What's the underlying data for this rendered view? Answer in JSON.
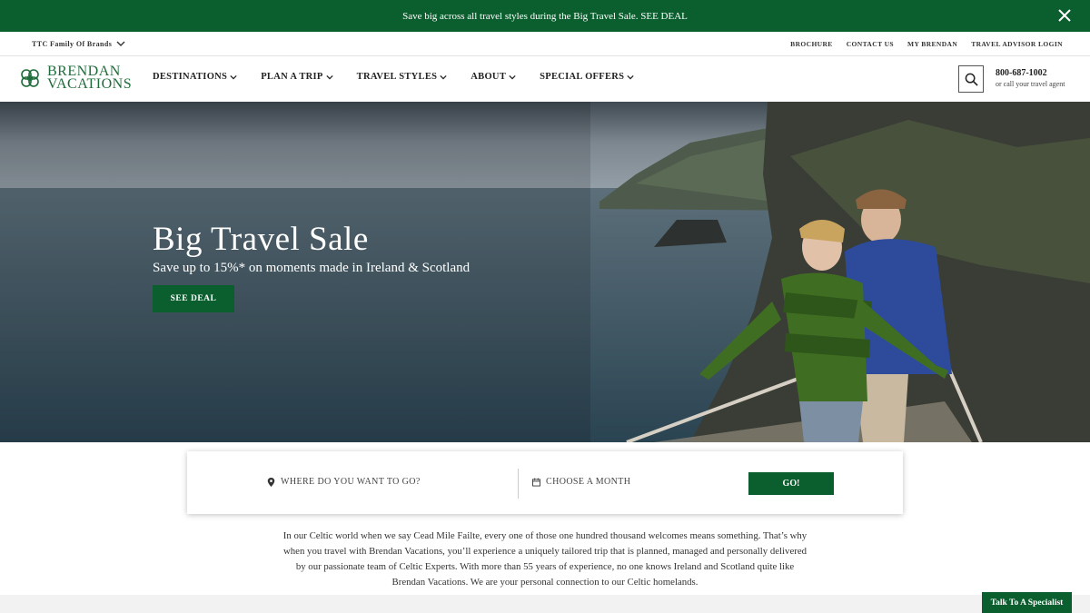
{
  "promo": {
    "text": "Save big across all travel styles during the Big Travel Sale. SEE DEAL",
    "close_icon": "close-icon"
  },
  "utility": {
    "family_label": "TTC Family Of Brands",
    "links": [
      "BROCHURE",
      "CONTACT US",
      "MY BRENDAN",
      "TRAVEL ADVISOR LOGIN"
    ]
  },
  "nav": {
    "logo_line1": "BRENDAN",
    "logo_line2": "VACATIONS",
    "menu": [
      "DESTINATIONS",
      "PLAN A TRIP",
      "TRAVEL STYLES",
      "ABOUT",
      "SPECIAL OFFERS"
    ],
    "phone": "800-687-1002",
    "phone_sub": "or call your travel agent"
  },
  "hero": {
    "title": "Big Travel Sale",
    "subtitle": "Save up to 15%* on moments made in Ireland & Scotland",
    "button": "SEE DEAL"
  },
  "search": {
    "where": "WHERE DO YOU WANT TO GO?",
    "month": "CHOOSE A MONTH",
    "go": "GO!"
  },
  "intro": "In our Celtic world when we say Cead Mile Failte, every one of those one hundred thousand welcomes means something. That’s why when you travel with Brendan Vacations, you’ll experience a uniquely tailored trip that is planned, managed and personally delivered by our passionate team of Celtic Experts. With more than 55 years of experience, no one knows Ireland and Scotland quite like Brendan Vacations. We are your personal connection to our Celtic homelands.",
  "specialist": "Talk To A Specialist",
  "colors": {
    "brand_green": "#0b5e2e",
    "logo_green": "#1f6b3a"
  }
}
